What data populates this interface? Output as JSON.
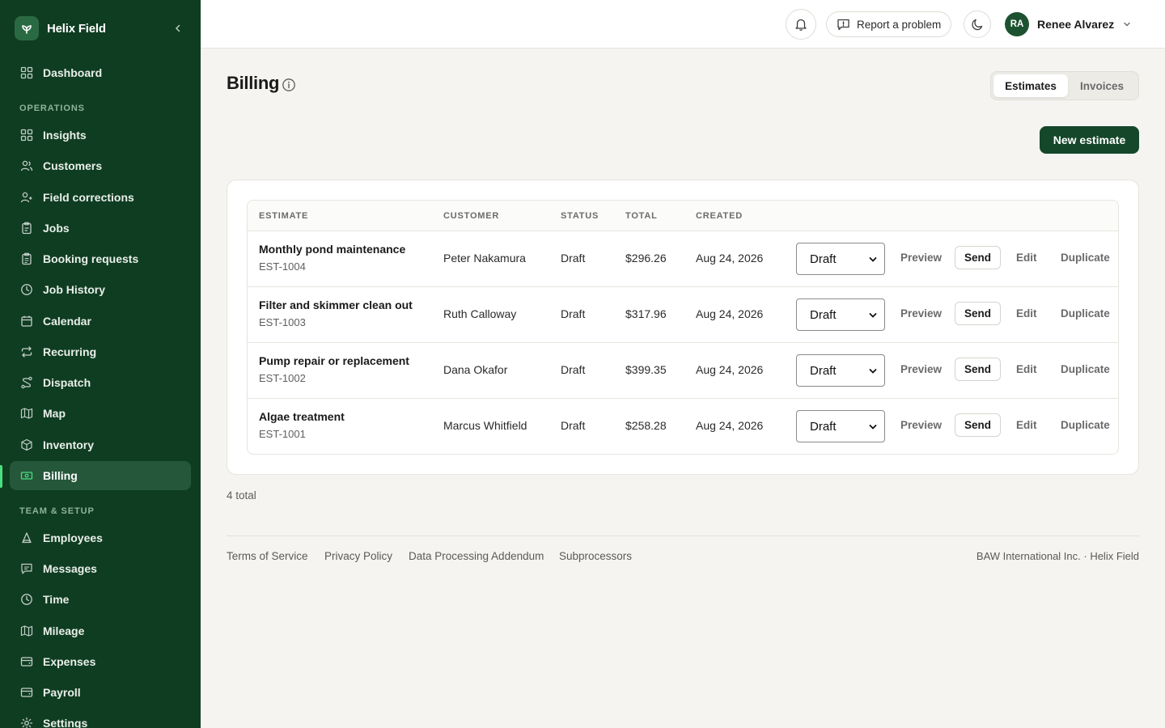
{
  "app": {
    "name": "Helix Field"
  },
  "sidebar": {
    "sections": {
      "operations": "OPERATIONS",
      "team_setup": "TEAM & SETUP"
    },
    "items": [
      {
        "label": "Dashboard",
        "icon": "dashboard-grid-icon"
      },
      {
        "label": "Insights",
        "icon": "insights-grid-icon"
      },
      {
        "label": "Customers",
        "icon": "users-icon"
      },
      {
        "label": "Field corrections",
        "icon": "user-group-icon"
      },
      {
        "label": "Jobs",
        "icon": "clipboard-icon"
      },
      {
        "label": "Booking requests",
        "icon": "clipboard-list-icon"
      },
      {
        "label": "Job History",
        "icon": "clock-icon"
      },
      {
        "label": "Calendar",
        "icon": "calendar-icon"
      },
      {
        "label": "Recurring",
        "icon": "repeat-icon"
      },
      {
        "label": "Dispatch",
        "icon": "route-icon"
      },
      {
        "label": "Map",
        "icon": "map-icon"
      },
      {
        "label": "Inventory",
        "icon": "box-icon"
      },
      {
        "label": "Billing",
        "icon": "banknote-icon",
        "active": true
      },
      {
        "label": "Employees",
        "icon": "person-icon"
      },
      {
        "label": "Messages",
        "icon": "message-icon"
      },
      {
        "label": "Time",
        "icon": "clock-icon"
      },
      {
        "label": "Mileage",
        "icon": "map-icon"
      },
      {
        "label": "Expenses",
        "icon": "wallet-icon"
      },
      {
        "label": "Payroll",
        "icon": "wallet-icon"
      },
      {
        "label": "Settings",
        "icon": "gear-icon"
      }
    ]
  },
  "topbar": {
    "report_label": "Report a problem",
    "user": {
      "initials": "RA",
      "name": "Renee Alvarez"
    }
  },
  "page": {
    "title": "Billing",
    "tabs": [
      {
        "label": "Estimates",
        "active": true
      },
      {
        "label": "Invoices",
        "active": false
      }
    ],
    "new_button": "New estimate"
  },
  "table": {
    "columns": [
      "ESTIMATE",
      "CUSTOMER",
      "STATUS",
      "TOTAL",
      "CREATED"
    ],
    "rows": [
      {
        "title": "Monthly pond maintenance",
        "id": "EST-1004",
        "customer": "Peter Nakamura",
        "status": "Draft",
        "total": "$296.26",
        "created": "Aug 24, 2026",
        "select": "Draft"
      },
      {
        "title": "Filter and skimmer clean out",
        "id": "EST-1003",
        "customer": "Ruth Calloway",
        "status": "Draft",
        "total": "$317.96",
        "created": "Aug 24, 2026",
        "select": "Draft"
      },
      {
        "title": "Pump repair or replacement",
        "id": "EST-1002",
        "customer": "Dana Okafor",
        "status": "Draft",
        "total": "$399.35",
        "created": "Aug 24, 2026",
        "select": "Draft"
      },
      {
        "title": "Algae treatment",
        "id": "EST-1001",
        "customer": "Marcus Whitfield",
        "status": "Draft",
        "total": "$258.28",
        "created": "Aug 24, 2026",
        "select": "Draft"
      }
    ],
    "actions": {
      "preview": "Preview",
      "send": "Send",
      "edit": "Edit",
      "duplicate": "Duplicate"
    }
  },
  "summary": {
    "total_text": "4 total"
  },
  "footer": {
    "links": [
      "Terms of Service",
      "Privacy Policy",
      "Data Processing Addendum",
      "Subprocessors"
    ],
    "copyright": "BAW International Inc. · Helix Field"
  },
  "colors": {
    "sidebar_bg": "#0f3d22",
    "accent": "#15472a",
    "active_indicator": "#4ade80",
    "page_bg": "#f5f4f0"
  }
}
